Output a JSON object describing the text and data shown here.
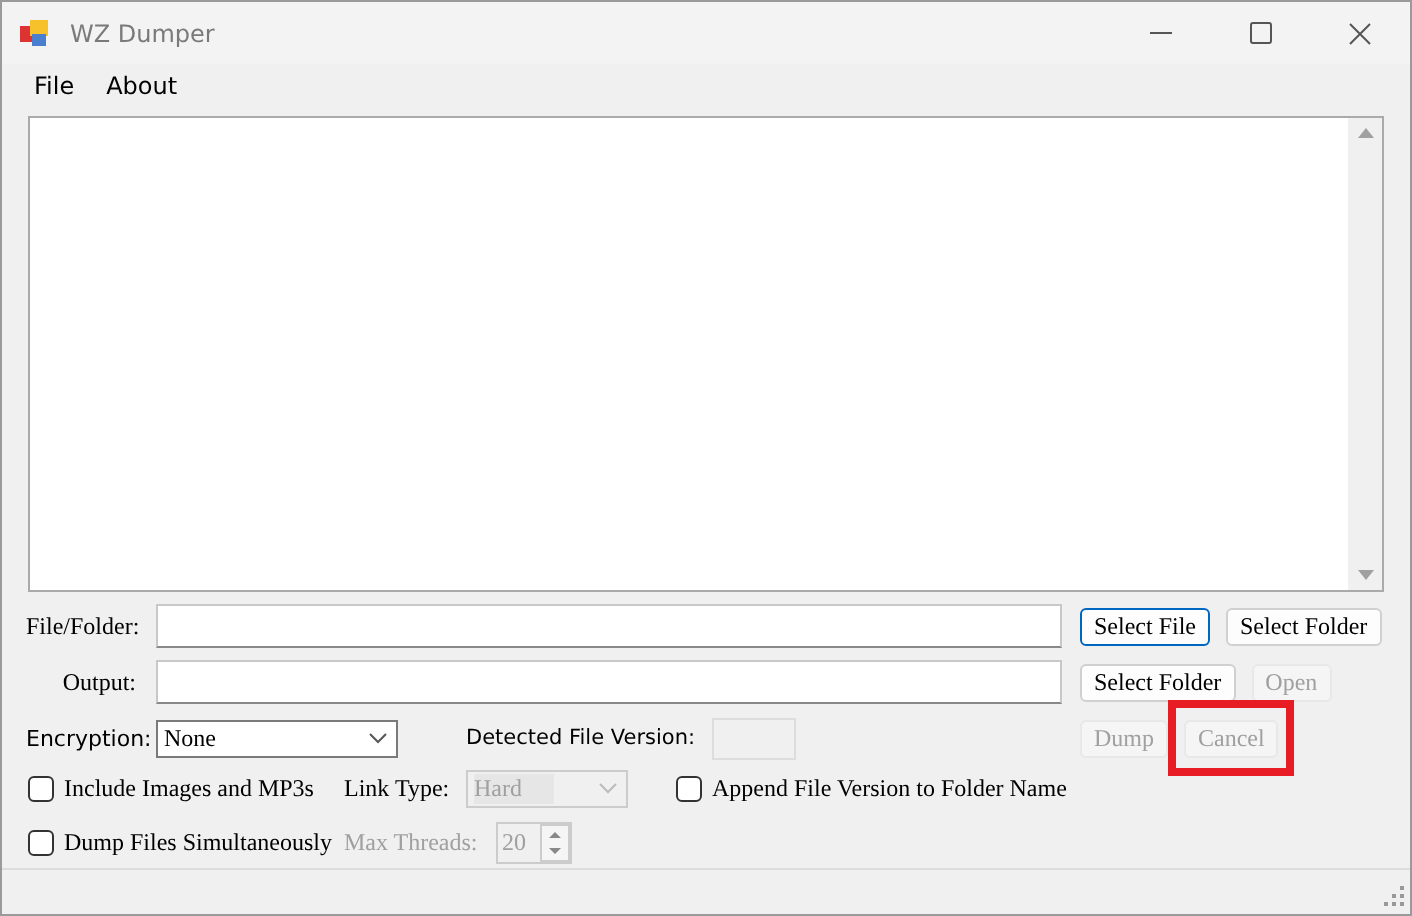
{
  "window": {
    "title": "WZ Dumper"
  },
  "menu": [
    {
      "label": "File"
    },
    {
      "label": "About"
    }
  ],
  "file_folder": {
    "label": "File/Folder:",
    "buttons": [
      {
        "label": "Select File",
        "disabled": false,
        "focused": true,
        "highlighted": false
      },
      {
        "label": "Select Folder",
        "disabled": false,
        "focused": false,
        "highlighted": false
      }
    ]
  },
  "output": {
    "label": "Output:",
    "buttons": [
      {
        "label": "Select Folder",
        "disabled": false,
        "focused": false,
        "highlighted": false
      },
      {
        "label": "Open",
        "disabled": true,
        "focused": false,
        "highlighted": false
      }
    ]
  },
  "encryption": {
    "label": "Encryption:",
    "value": "None",
    "disabled": false
  },
  "detected_version": {
    "label": "Detected File Version:"
  },
  "actions": [
    {
      "label": "Dump",
      "disabled": true,
      "focused": false,
      "highlighted": false
    },
    {
      "label": "Cancel",
      "disabled": true,
      "focused": false,
      "highlighted": true
    }
  ],
  "include_images": {
    "label": "Include Images and MP3s",
    "checked": false
  },
  "link_type": {
    "label": "Link Type:",
    "value": "Hard",
    "disabled": true
  },
  "append_version": {
    "label": "Append File Version to Folder Name",
    "checked": false
  },
  "dump_simultaneously": {
    "label": "Dump Files Simultaneously",
    "checked": false
  },
  "max_threads": {
    "label": "Max Threads:",
    "value": "20",
    "disabled": true
  }
}
